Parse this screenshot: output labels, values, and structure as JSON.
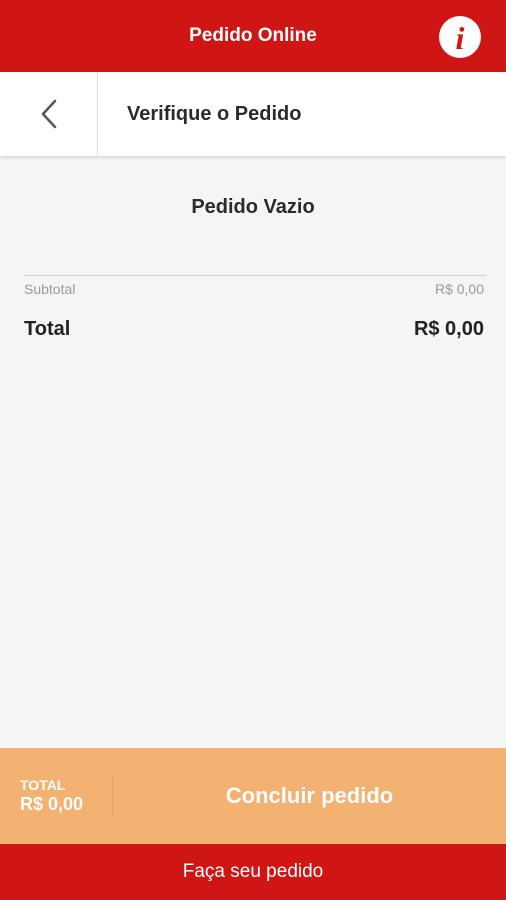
{
  "header": {
    "title": "Pedido Online",
    "info_icon": "info-icon",
    "info_glyph": "i"
  },
  "sub_header": {
    "back_icon": "chevron-left-icon",
    "title": "Verifique o Pedido"
  },
  "order": {
    "empty_label": "Pedido Vazio",
    "subtotal_label": "Subtotal",
    "subtotal_value": "R$ 0,00",
    "total_label": "Total",
    "total_value": "R$ 0,00"
  },
  "bottom_bar": {
    "total_caption": "TOTAL",
    "total_value": "R$ 0,00",
    "conclude_label": "Concluir pedido"
  },
  "footer": {
    "label": "Faça seu pedido"
  },
  "colors": {
    "brand_red": "#d01515",
    "accent_orange": "#f3b172",
    "background": "#f5f5f5"
  }
}
